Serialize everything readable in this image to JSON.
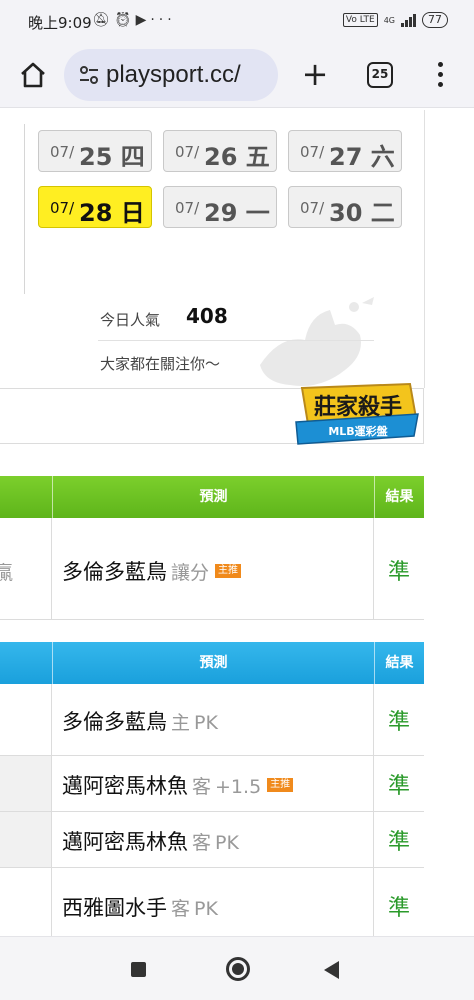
{
  "status_bar": {
    "time": "晚上9:09",
    "icons": [
      "mute-icon",
      "alarm-icon",
      "youtube-icon",
      "more-dots-icon"
    ],
    "network": "4G",
    "volte": "Vo LTE",
    "battery": "77"
  },
  "browser": {
    "url": "playsport.cc/",
    "tab_count": "25"
  },
  "dates": [
    {
      "month": "07/",
      "day": "25 四",
      "active": false
    },
    {
      "month": "07/",
      "day": "26 五",
      "active": false
    },
    {
      "month": "07/",
      "day": "27 六",
      "active": false
    },
    {
      "month": "07/",
      "day": "28 日",
      "active": true
    },
    {
      "month": "07/",
      "day": "29 一",
      "active": false
    },
    {
      "month": "07/",
      "day": "30 二",
      "active": false
    }
  ],
  "popularity": {
    "label": "今日人氣",
    "value": "408",
    "note": "大家都在關注你～"
  },
  "badge": {
    "title": "莊家殺手",
    "subtitle": "MLB運彩盤"
  },
  "table1": {
    "header": {
      "prediction": "預測",
      "result": "結果"
    },
    "rows": [
      {
        "left_partial": "贏",
        "team": "多倫多藍鳥",
        "side": "",
        "handicap": "讓分",
        "tag": "主推",
        "result": "準"
      }
    ]
  },
  "table2": {
    "header": {
      "prediction": "預測",
      "result": "結果"
    },
    "rows": [
      {
        "team": "多倫多藍鳥",
        "side": "主",
        "handicap": "PK",
        "tag": "",
        "result": "準"
      },
      {
        "team": "邁阿密馬林魚",
        "side": "客",
        "handicap": "+1.5",
        "tag": "主推",
        "result": "準"
      },
      {
        "team": "邁阿密馬林魚",
        "side": "客",
        "handicap": "PK",
        "tag": "",
        "result": "準"
      },
      {
        "team": "西雅圖水手",
        "side": "客",
        "handicap": "PK",
        "tag": "",
        "result": "準"
      }
    ]
  }
}
